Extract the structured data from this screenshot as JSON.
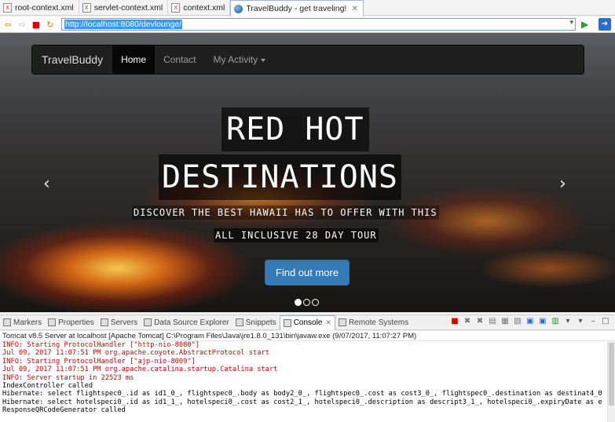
{
  "editor_tabs": [
    {
      "label": "root-context.xml",
      "type": "xml"
    },
    {
      "label": "servlet-context.xml",
      "type": "xml"
    },
    {
      "label": "context.xml",
      "type": "xml"
    },
    {
      "label": "TravelBuddy - get traveling!",
      "type": "browser",
      "close": "✕"
    }
  ],
  "url_bar": {
    "url": "http://localhost:8080/devlounge/"
  },
  "site": {
    "brand": "TravelBuddy",
    "nav": [
      {
        "label": "Home",
        "active": true
      },
      {
        "label": "Contact",
        "active": false
      },
      {
        "label": "My Activity",
        "active": false,
        "dropdown": true
      }
    ],
    "hero": {
      "line1": "RED HOT",
      "line2": "DESTINATIONS",
      "sub1": "DISCOVER THE BEST HAWAII HAS TO OFFER WITH THIS",
      "sub2": "ALL INCLUSIVE 28 DAY TOUR",
      "cta": "Find out more",
      "prev_icon": "‹",
      "next_icon": "›",
      "slides": 3,
      "active_slide": 1
    }
  },
  "views": [
    {
      "label": "Markers",
      "icon": "markers-icon"
    },
    {
      "label": "Properties",
      "icon": "properties-icon"
    },
    {
      "label": "Servers",
      "icon": "servers-icon"
    },
    {
      "label": "Data Source Explorer",
      "icon": "datasource-icon"
    },
    {
      "label": "Snippets",
      "icon": "snippets-icon"
    },
    {
      "label": "Console",
      "icon": "console-icon",
      "active": true
    },
    {
      "label": "Remote Systems",
      "icon": "remote-icon"
    }
  ],
  "console": {
    "title": "Tomcat v8.5 Server at localhost [Apache Tomcat] C:\\Program Files\\Java\\jre1.8.0_131\\bin\\javaw.exe (9/07/2017, 11:07:27 PM)",
    "lines": [
      {
        "text": "INFO: Starting ProtocolHandler [\"http-nio-8080\"]",
        "color": "red"
      },
      {
        "text": "Jul 09, 2017 11:07:51 PM org.apache.coyote.AbstractProtocol start",
        "color": "red"
      },
      {
        "text": "INFO: Starting ProtocolHandler [\"ajp-nio-8009\"]",
        "color": "red"
      },
      {
        "text": "Jul 09, 2017 11:07:51 PM org.apache.catalina.startup.Catalina start",
        "color": "red"
      },
      {
        "text": "INFO: Server startup in 22523 ms",
        "color": "red"
      },
      {
        "text": "IndexController called",
        "color": "black"
      },
      {
        "text": "Hibernate: select flightspec0_.id as id1_0_, flightspec0_.body as body2_0_, flightspec0_.cost as cost3_0_, flightspec0_.destination as destinat4_0",
        "color": "black"
      },
      {
        "text": "Hibernate: select hotelspeci0_.id as id1_1_, hotelspeci0_.cost as cost2_1_, hotelspeci0_.description as descript3_1_, hotelspeci0_.expiryDate as e",
        "color": "black"
      },
      {
        "text": "ResponseQRCodeGenerator called",
        "color": "black"
      }
    ]
  }
}
